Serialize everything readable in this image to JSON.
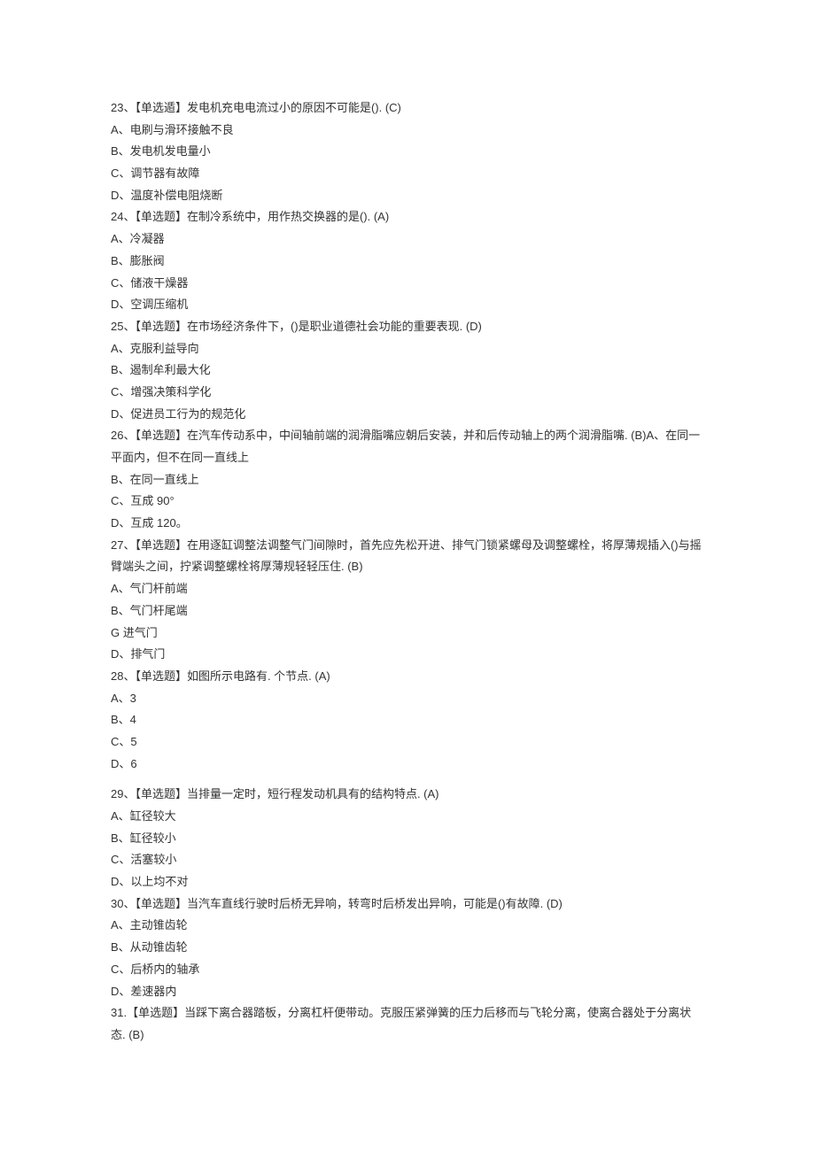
{
  "lines": [
    "23、【单选遁】发电机充电电流过小的原因不可能是(). (C)",
    "A、电刷与滑环接触不良",
    "B、发电机发电量小",
    "C、调节器有故障",
    "D、温度补偿电阻烧断",
    "24、【单选题】在制冷系统中，用作热交换器的是(). (A)",
    "A、冷凝器",
    "B、膨胀阀",
    "C、储液干燥器",
    "D、空调压缩机",
    "25、【单选题】在市场经济条件下，()是职业道德社会功能的重要表现. (D)",
    "A、克服利益导向",
    "B、遏制牟利最大化",
    "C、增强决策科学化",
    "D、促进员工行为的规范化",
    "26、【单选题】在汽车传动系中，中间轴前端的润滑脂嘴应朝后安装，并和后传动轴上的两个润滑脂嘴. (B)A、在同一平面内，但不在同一直线上",
    "B、在同一直线上",
    "C、互成 90°",
    "D、互成 120。",
    "27、【单选题】在用逐缸调整法调整气门间隙时，首先应先松开进、排气门锁紧螺母及调整螺栓，将厚薄规插入()与摇臂端头之间，拧紧调整螺栓将厚薄规轻轻压住. (B)",
    "A、气门杆前端",
    "B、气门杆尾端",
    "G 进气门",
    "D、排气门",
    "28、【单选题】如图所示电路有. 个节点. (A)",
    "A、3",
    "B、4",
    "C、5",
    "D、6",
    "29、【单选题】当排量一定时，短行程发动机具有的结构特点. (A)",
    "A、缸径较大",
    "B、缸径较小",
    "C、活塞较小",
    "D、以上均不对",
    "30、【单选题】当汽车直线行驶时后桥无异响，转弯时后桥发出异响，可能是()有故障. (D)",
    "A、主动锥齿轮",
    "B、从动锥齿轮",
    "C、后桥内的轴承",
    "D、差速器内",
    "31.【单选题】当踩下离合器踏板，分离杠杆便带动。克服压紧弹簧的压力后移而与飞轮分离，使离合器处于分离状态. (B)"
  ],
  "gaps": {
    "after_28": true
  }
}
